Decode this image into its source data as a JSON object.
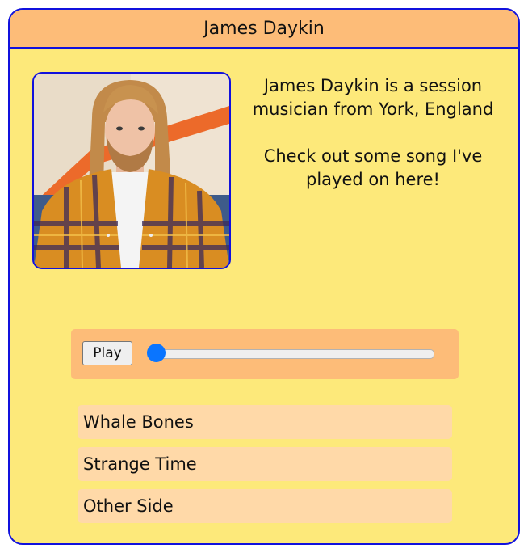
{
  "header": {
    "title": "James Daykin"
  },
  "bio": {
    "line1": "James Daykin is a session musician from York, England",
    "line2": "Check out some song I've played on here!"
  },
  "player": {
    "play_label": "Play",
    "progress": 0
  },
  "tracks": [
    {
      "title": "Whale Bones"
    },
    {
      "title": "Strange Time"
    },
    {
      "title": "Other Side"
    }
  ],
  "colors": {
    "card_bg": "#fde97a",
    "header_bg": "#fdbc78",
    "border": "#1111dd",
    "track_bg": "#ffd9a8",
    "slider_thumb": "#0a75ff"
  }
}
